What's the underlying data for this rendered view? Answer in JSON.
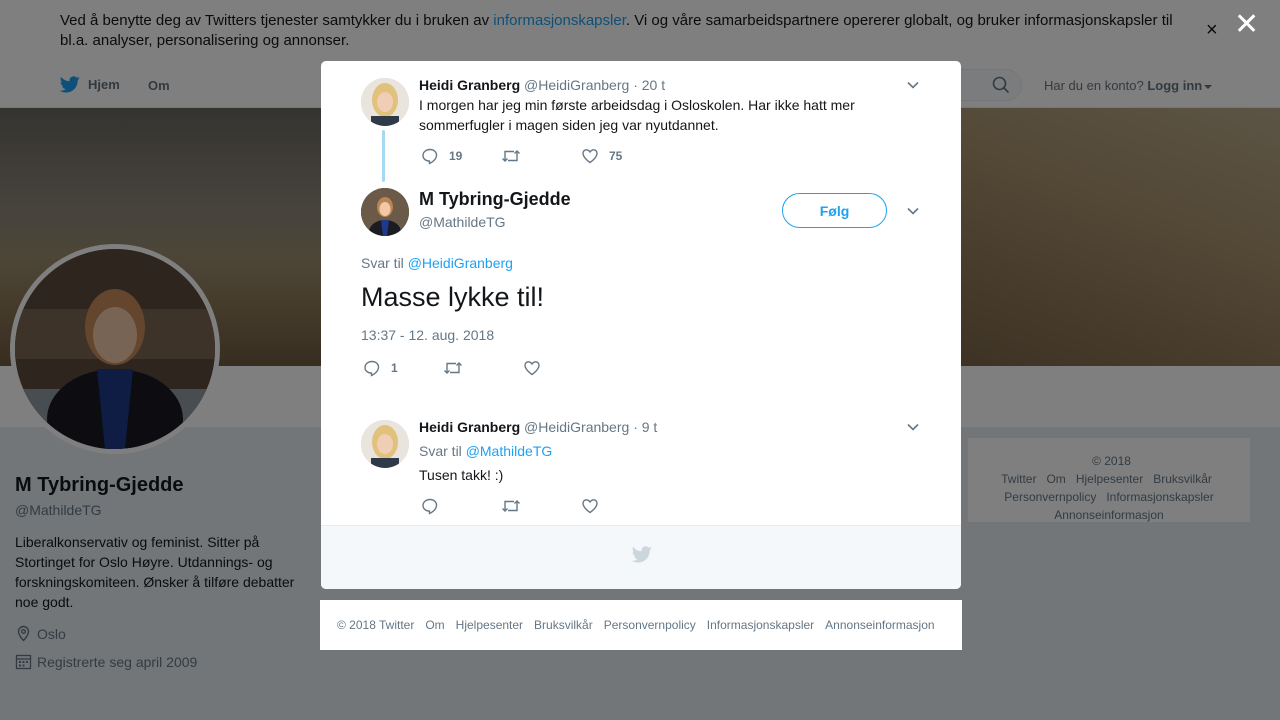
{
  "cookie_bar": {
    "text_before": "Ved å benytte deg av Twitters tjenester samtykker du i bruken av ",
    "link": "informasjonskapsler",
    "text_after": ". Vi og våre samarbeidspartnere opererer globalt, og bruker informasjonskapsler til bl.a. analyser, personalisering og annonser.",
    "close": "×"
  },
  "nav": {
    "home": "Hjem",
    "about": "Om",
    "account_question": "Har du en konto?",
    "login": "Logg inn"
  },
  "profile": {
    "name": "M Tybring-Gjedde",
    "handle": "@MathildeTG",
    "bio": "Liberalkonservativ og feminist. Sitter på Stortinget for Oslo Høyre. Utdannings- og forskningskomiteen. Ønsker å tilføre debatter noe godt.",
    "location": "Oslo",
    "joined": "Registrerte seg april 2009"
  },
  "side_footer": {
    "links": [
      "© 2018 Twitter",
      "Om",
      "Hjelpesenter",
      "Bruksvilkår",
      "Personvernpolicy",
      "Informasjonskapsler",
      "Annonseinformasjon"
    ]
  },
  "overlay": {
    "close": "✕"
  },
  "modal": {
    "parent_tweet": {
      "name": "Heidi Granberg",
      "handle": "@HeidiGranberg",
      "time": "· 20 t",
      "text": "I morgen har jeg min første arbeidsdag i Osloskolen. Har ikke hatt mer sommerfugler i magen siden jeg var nyutdannet.",
      "replies": "19",
      "retweets": "",
      "likes": "75"
    },
    "main_tweet": {
      "name": "M Tybring-Gjedde",
      "handle": "@MathildeTG",
      "follow": "Følg",
      "reply_prefix": "Svar til",
      "reply_to": "@HeidiGranberg",
      "text": "Masse lykke til!",
      "timestamp": "13:37 - 12. aug. 2018",
      "replies": "1",
      "retweets": "",
      "likes": ""
    },
    "reply_tweet": {
      "name": "Heidi Granberg",
      "handle": "@HeidiGranberg",
      "time": "· 9 t",
      "reply_prefix": "Svar til",
      "reply_to": "@MathildeTG",
      "text": "Tusen takk! :)"
    }
  },
  "bottom_footer": {
    "links": [
      "© 2018 Twitter",
      "Om",
      "Hjelpesenter",
      "Bruksvilkår",
      "Personvernpolicy",
      "Informasjonskapsler",
      "Annonseinformasjon"
    ]
  },
  "colors": {
    "accent": "#1da1f2",
    "muted": "#657786",
    "text": "#14171a"
  },
  "icons": [
    "twitter-bird-icon",
    "search-icon",
    "location-icon",
    "calendar-icon",
    "reply-icon",
    "retweet-icon",
    "like-icon",
    "chevron-down-icon",
    "close-icon"
  ]
}
